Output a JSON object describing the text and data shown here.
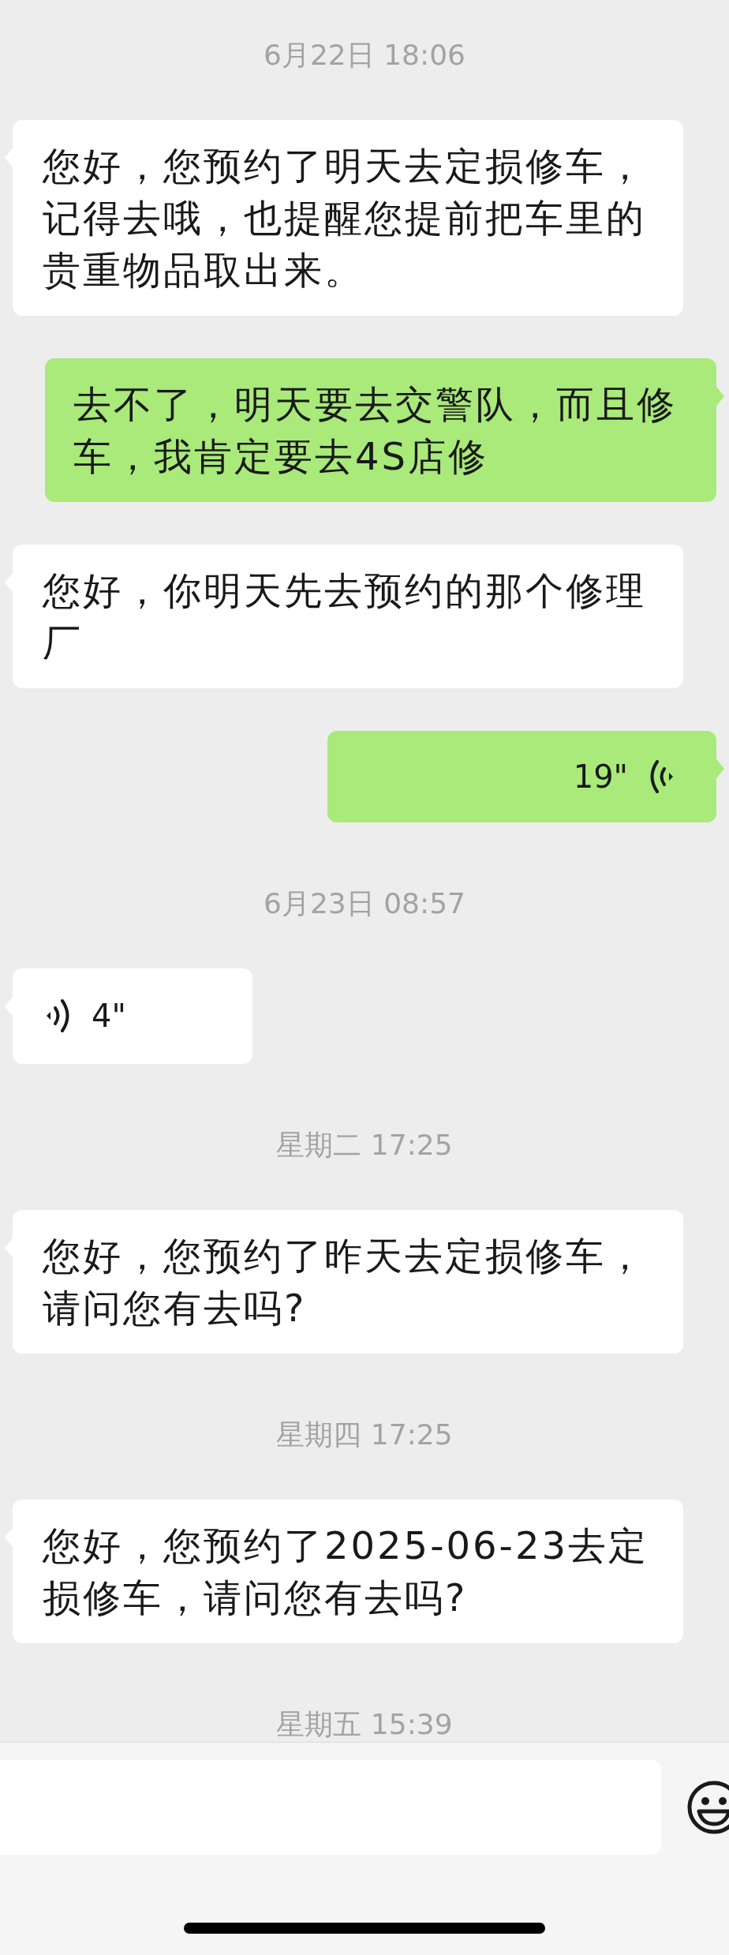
{
  "messages": [
    {
      "kind": "time",
      "text": "6月22日 18:06"
    },
    {
      "kind": "text",
      "outgoing": false,
      "text": "您好，您预约了明天去定损修车，记得去哦，也提醒您提前把车里的贵重物品取出来。"
    },
    {
      "kind": "text",
      "outgoing": true,
      "text": "去不了，明天要去交警队，而且修车，我肯定要去4S店修"
    },
    {
      "kind": "text",
      "outgoing": false,
      "text": "您好，你明天先去预约的那个修理厂"
    },
    {
      "kind": "voice",
      "outgoing": true,
      "duration": "19\""
    },
    {
      "kind": "time",
      "text": "6月23日 08:57"
    },
    {
      "kind": "voice",
      "outgoing": false,
      "duration": "4\""
    },
    {
      "kind": "time",
      "text": "星期二 17:25"
    },
    {
      "kind": "text",
      "outgoing": false,
      "text": "您好，您预约了昨天去定损修车，请问您有去吗?"
    },
    {
      "kind": "time",
      "text": "星期四 17:25"
    },
    {
      "kind": "text",
      "outgoing": false,
      "text": "您好，您预约了2025-06-23去定损修车，请问您有去吗?"
    },
    {
      "kind": "time",
      "text": "星期五 15:39"
    }
  ]
}
